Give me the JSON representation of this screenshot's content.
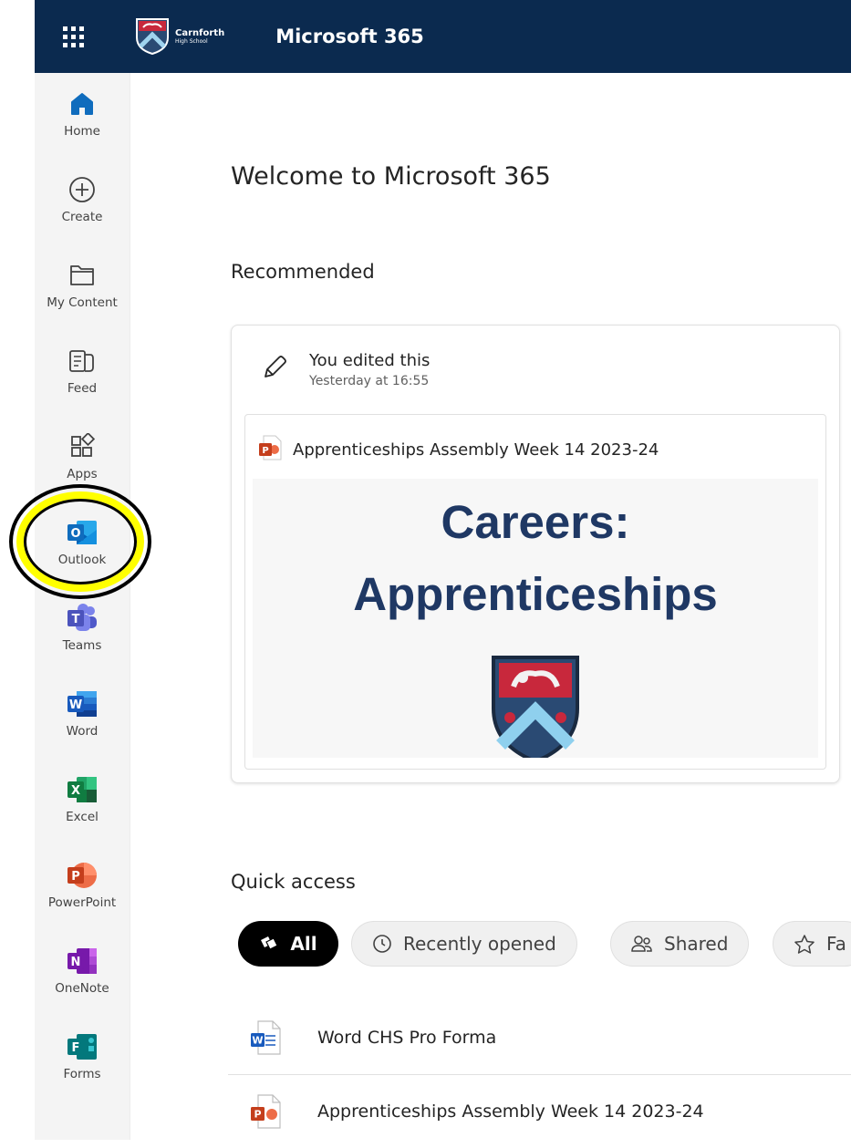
{
  "header": {
    "app_title": "Microsoft 365",
    "school_name_line1": "Carnforth",
    "school_name_line2": "High School",
    "background_color": "#0b2a4f"
  },
  "rail": {
    "items": [
      {
        "label": "Home",
        "icon": "home-icon"
      },
      {
        "label": "Create",
        "icon": "plus-circle-icon"
      },
      {
        "label": "My Content",
        "icon": "folder-icon"
      },
      {
        "label": "Feed",
        "icon": "feed-icon"
      },
      {
        "label": "Apps",
        "icon": "apps-icon"
      },
      {
        "label": "Outlook",
        "icon": "outlook-icon"
      },
      {
        "label": "Teams",
        "icon": "teams-icon"
      },
      {
        "label": "Word",
        "icon": "word-icon"
      },
      {
        "label": "Excel",
        "icon": "excel-icon"
      },
      {
        "label": "PowerPoint",
        "icon": "powerpoint-icon"
      },
      {
        "label": "OneNote",
        "icon": "onenote-icon"
      },
      {
        "label": "Forms",
        "icon": "forms-icon"
      }
    ]
  },
  "main": {
    "welcome_title": "Welcome to Microsoft 365",
    "recommended_heading": "Recommended",
    "recommended_card": {
      "activity": "You edited this",
      "time": "Yesterday at 16:55",
      "file_name": "Apprenticeships Assembly Week 14 2023-24",
      "preview_line1": "Careers:",
      "preview_line2": "Apprenticeships"
    },
    "quick_access_heading": "Quick access",
    "filters": [
      {
        "label": "All",
        "active": true
      },
      {
        "label": "Recently opened",
        "active": false
      },
      {
        "label": "Shared",
        "active": false
      },
      {
        "label": "Fa",
        "active": false
      }
    ],
    "files": [
      {
        "name": "Word CHS Pro Forma",
        "type": "word"
      },
      {
        "name": "Apprenticeships Assembly Week 14 2023-24",
        "type": "powerpoint"
      }
    ]
  },
  "annotation": {
    "highlight_color": "#ffff00"
  }
}
